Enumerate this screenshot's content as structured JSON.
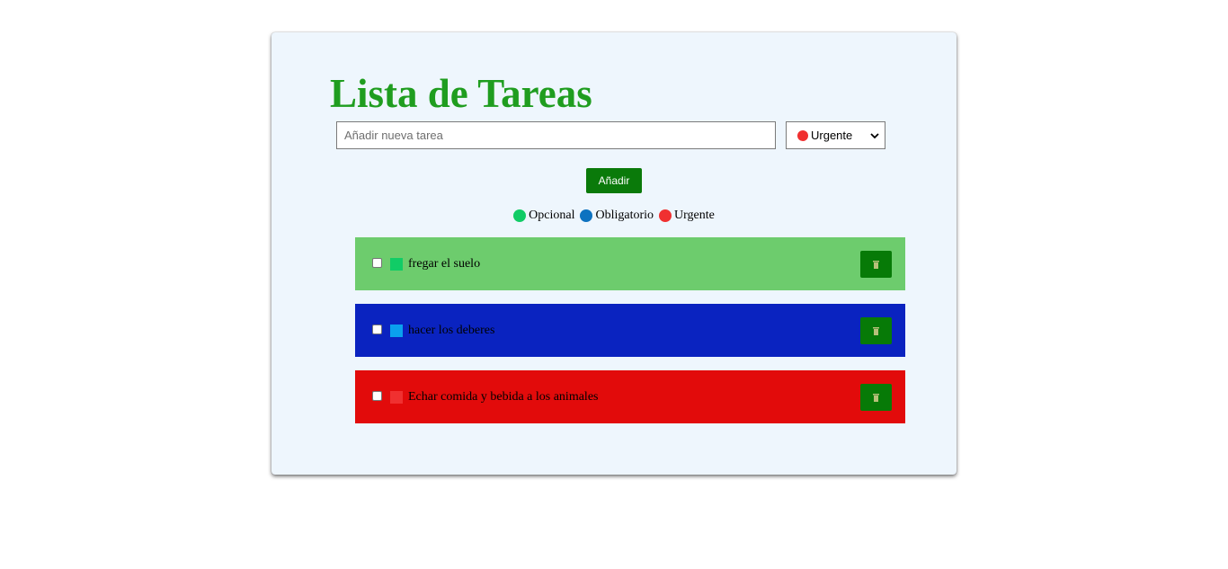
{
  "header": {
    "title": "Lista de Tareas"
  },
  "form": {
    "input_placeholder": "Añadir nueva tarea",
    "input_value": "",
    "select_value": "Urgente",
    "select_dot_color": "#f03030",
    "add_button_label": "Añadir"
  },
  "legend": [
    {
      "label": "Opcional",
      "color": "#11cc66"
    },
    {
      "label": "Obligatorio",
      "color": "#0d72c0"
    },
    {
      "label": "Urgente",
      "color": "#f03030"
    }
  ],
  "tasks": [
    {
      "text": "fregar el suelo",
      "checked": false,
      "priority": "Opcional",
      "row_color": "#6dcc6d",
      "swatch_color": "#11cc66",
      "delete_icon": "trash-icon"
    },
    {
      "text": "hacer los deberes",
      "checked": false,
      "priority": "Obligatorio",
      "row_color": "#0a23c0",
      "swatch_color": "#0aa0ee",
      "delete_icon": "trash-icon"
    },
    {
      "text": "Echar comida y bebida a los animales",
      "checked": false,
      "priority": "Urgente",
      "row_color": "#e20b0b",
      "swatch_color": "#f03030",
      "delete_icon": "trash-icon"
    }
  ],
  "colors": {
    "title": "#1f9d1f",
    "card_background": "#eef6fd",
    "button_green": "#0a7a0a"
  }
}
